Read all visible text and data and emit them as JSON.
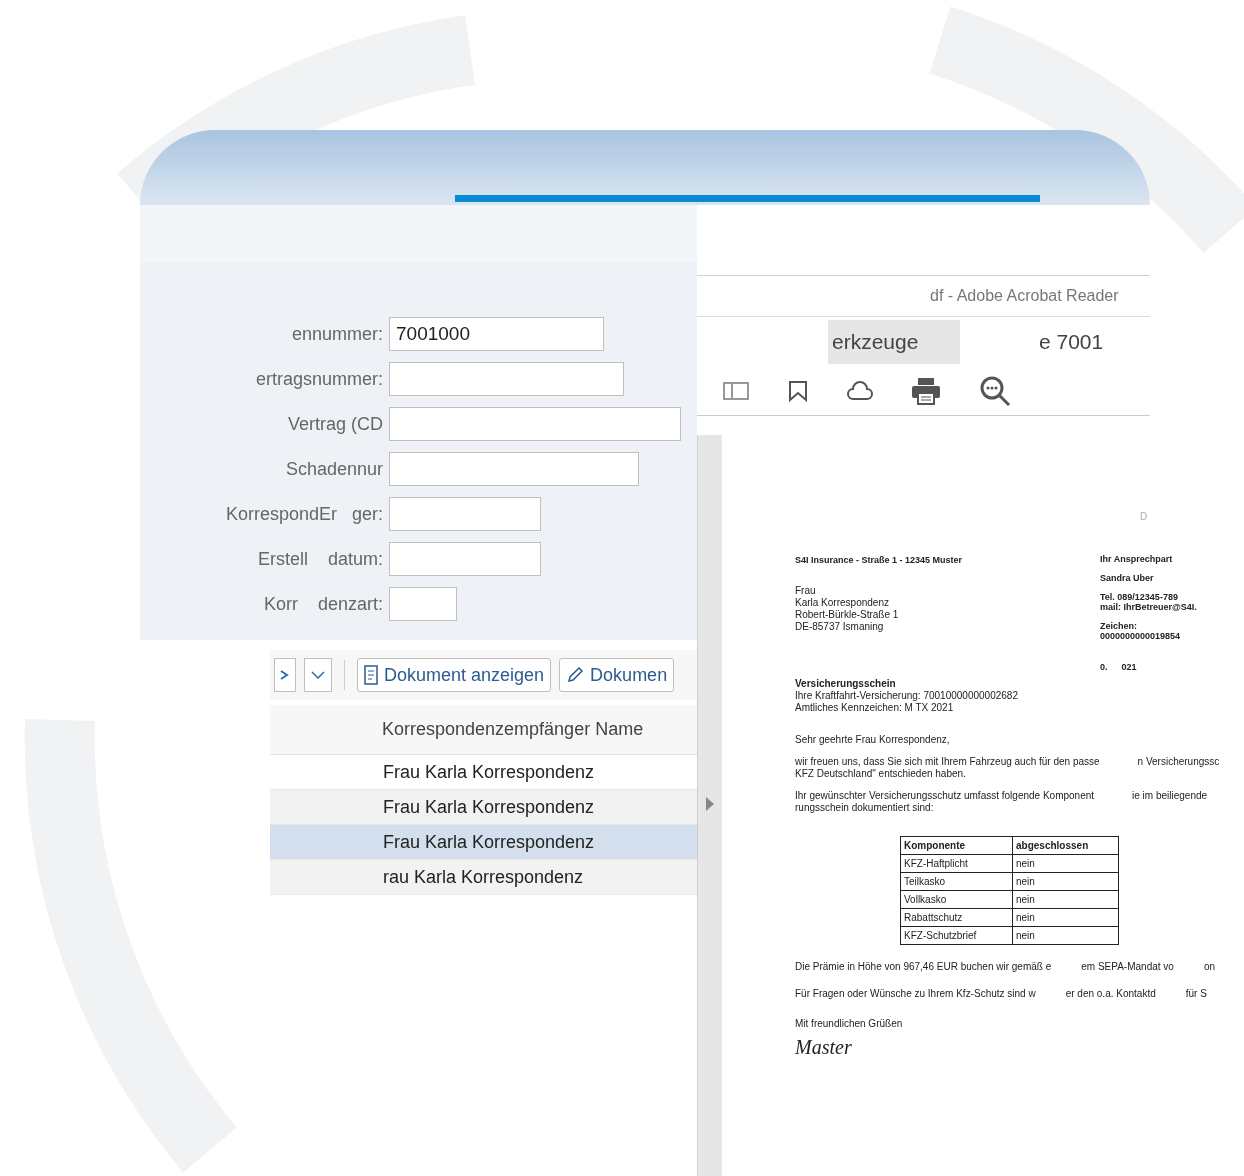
{
  "app_window": {
    "form_fields": [
      {
        "label": "ennummer:",
        "value": "7001000"
      },
      {
        "label": "ertragsnummer:"
      },
      {
        "label": "Vertrag (CD"
      },
      {
        "label": "Schadennur"
      },
      {
        "label": "KorrespondEr   ger:"
      },
      {
        "label": "Erstell    datum:"
      },
      {
        "label": "Korr    denzart:"
      }
    ],
    "toolbar": {
      "buttons": [
        {
          "kind": "settings"
        },
        {
          "kind": "dropdown"
        },
        {
          "kind": "document",
          "label": "Dokument anzeigen"
        },
        {
          "kind": "edit",
          "label": "Dokumen"
        }
      ]
    },
    "table": {
      "columns": [
        "Korrespondenzempfänger Name"
      ],
      "rows": [
        {
          "name": "Frau Karla Korrespondenz",
          "selected": false
        },
        {
          "name": "Frau Karla Korrespondenz",
          "selected": false
        },
        {
          "name": "Frau Karla Korrespondenz",
          "selected": true
        },
        {
          "name": "rau Karla Korrespondenz",
          "selected": false
        }
      ]
    }
  },
  "pdf_viewer": {
    "title": "df - Adobe Acrobat Reader",
    "tabs": [
      {
        "label": "erkzeuge",
        "selected": true
      },
      {
        "label": "e 7001",
        "selected": false
      }
    ],
    "document": {
      "corner": "D",
      "sender": "S4I Insurance - Straße 1 - 12345 Muster",
      "address": [
        "Frau",
        "Karla Korrespondenz",
        "Robert-Bürkle-Straße 1",
        "DE-85737 Ismaning"
      ],
      "contact": [
        "Ihr Ansprechpart",
        "Sandra Uber",
        "Tel. 089/12345-789",
        "mail: IhrBetreuer@S4I.",
        "Zeichen:",
        "0000000000019854"
      ],
      "date": [
        "0.",
        "021"
      ],
      "heading": "Versicherungsschein",
      "heading_lines": [
        "Ihre Kraftfahrt-Versicherung: 70010000000002682",
        "Amtliches Kennzeichen: M TX 2021"
      ],
      "salutation": "Sehr geehrte Frau Korrespondenz,",
      "paragraphs": [
        [
          [
            "wir freuen uns, dass Sie sich mit Ihrem Fahrzeug auch für den passe",
            "n Versicherungssc"
          ],
          [
            "KFZ Deutschland\" entschieden haben."
          ]
        ],
        [
          [
            "Ihr gewünschter Versicherungsschutz umfasst folgende Komponent",
            "ie im beiliegende"
          ],
          [
            "rungsschein dokumentiert sind:"
          ]
        ]
      ],
      "table": {
        "columns": [
          "Komponente",
          "abgeschlossen"
        ],
        "rows": [
          [
            "KFZ-Haftplicht",
            "nein"
          ],
          [
            "Teilkasko",
            "nein"
          ],
          [
            "Vollkasko",
            "nein"
          ],
          [
            "Rabattschutz",
            "nein"
          ],
          [
            "KFZ-Schutzbrief",
            "nein"
          ]
        ]
      },
      "closing_lines": [
        [
          "Die Prämie in Höhe von 967,46 EUR buchen wir gemäß e",
          "em SEPA-Mandat vo",
          "on"
        ],
        [
          "Für Fragen oder Wünsche zu Ihrem Kfz-Schutz sind w",
          "er den o.a. Kontaktd",
          "für S"
        ]
      ],
      "greeting": "Mit freundlichen Grüßen",
      "signature": "Master"
    }
  }
}
